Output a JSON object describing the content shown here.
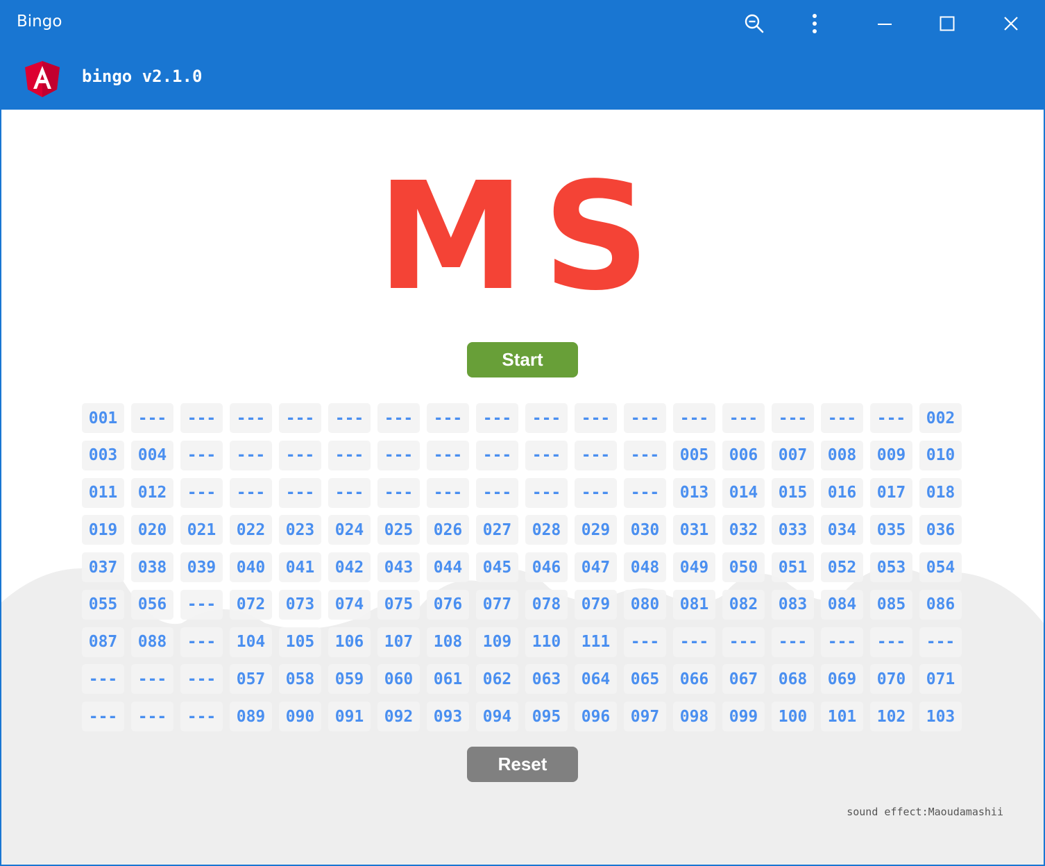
{
  "window": {
    "title": "Bingo",
    "icons": {
      "zoom": "zoom-out-icon",
      "menu": "more-vertical-icon",
      "minimize": "minimize-icon",
      "maximize": "maximize-icon",
      "close": "close-icon"
    }
  },
  "toolbar": {
    "logo": "angular-logo",
    "version": "bingo v2.1.0"
  },
  "display": {
    "current": "MS"
  },
  "buttons": {
    "start": "Start",
    "reset": "Reset"
  },
  "board": {
    "cells": [
      "001",
      "---",
      "---",
      "---",
      "---",
      "---",
      "---",
      "---",
      "---",
      "---",
      "---",
      "---",
      "---",
      "---",
      "---",
      "---",
      "---",
      "002",
      "003",
      "004",
      "---",
      "---",
      "---",
      "---",
      "---",
      "---",
      "---",
      "---",
      "---",
      "---",
      "005",
      "006",
      "007",
      "008",
      "009",
      "010",
      "011",
      "012",
      "---",
      "---",
      "---",
      "---",
      "---",
      "---",
      "---",
      "---",
      "---",
      "---",
      "013",
      "014",
      "015",
      "016",
      "017",
      "018",
      "019",
      "020",
      "021",
      "022",
      "023",
      "024",
      "025",
      "026",
      "027",
      "028",
      "029",
      "030",
      "031",
      "032",
      "033",
      "034",
      "035",
      "036",
      "037",
      "038",
      "039",
      "040",
      "041",
      "042",
      "043",
      "044",
      "045",
      "046",
      "047",
      "048",
      "049",
      "050",
      "051",
      "052",
      "053",
      "054",
      "055",
      "056",
      "---",
      "072",
      "073",
      "074",
      "075",
      "076",
      "077",
      "078",
      "079",
      "080",
      "081",
      "082",
      "083",
      "084",
      "085",
      "086",
      "087",
      "088",
      "---",
      "104",
      "105",
      "106",
      "107",
      "108",
      "109",
      "110",
      "111",
      "---",
      "---",
      "---",
      "---",
      "---",
      "---",
      "---",
      "---",
      "---",
      "---",
      "057",
      "058",
      "059",
      "060",
      "061",
      "062",
      "063",
      "064",
      "065",
      "066",
      "067",
      "068",
      "069",
      "070",
      "071",
      "---",
      "---",
      "---",
      "089",
      "090",
      "091",
      "092",
      "093",
      "094",
      "095",
      "096",
      "097",
      "098",
      "099",
      "100",
      "101",
      "102",
      "103"
    ]
  },
  "footer": {
    "credit": "sound effect:Maoudamashii"
  },
  "colors": {
    "primary": "#1976d2",
    "display": "#f44336",
    "start": "#689f38",
    "reset": "#808080",
    "cell_text": "#4a8ff0",
    "cell_bg": "#f3f3f3",
    "cloud": "#eeeeee"
  }
}
